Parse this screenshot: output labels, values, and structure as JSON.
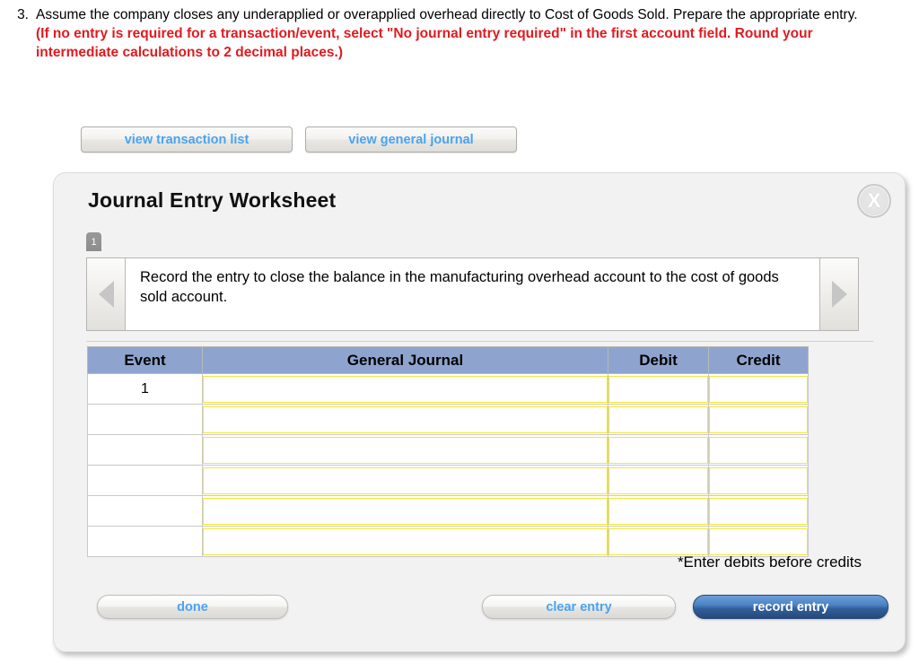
{
  "question": {
    "number": "3.",
    "text_plain": "Assume the company closes any underapplied or overapplied overhead directly to Cost of Goods Sold. Prepare the appropriate entry. ",
    "text_emphasis": "(If no entry is required for a transaction/event, select \"No journal entry required\" in the first account field. Round your intermediate calculations to 2 decimal places.)",
    "emphasis_color": "#e01b20"
  },
  "view_buttons": [
    {
      "label": "view transaction list",
      "name": "view-transaction-list-button"
    },
    {
      "label": "view general journal",
      "name": "view-general-journal-button"
    }
  ],
  "worksheet": {
    "title": "Journal Entry Worksheet",
    "close_icon": "close-icon",
    "close_glyph": "X",
    "tabs": [
      {
        "label": "1"
      }
    ],
    "nav": {
      "prev_icon": "chevron-left-icon",
      "next_icon": "chevron-right-icon",
      "prompt": "Record the entry to close the balance in the manufacturing overhead account to the cost of goods sold account."
    },
    "table": {
      "headers": [
        "Event",
        "General Journal",
        "Debit",
        "Credit"
      ],
      "header_color": "#8ea4ce",
      "input_border_color": "#f2e72f",
      "rows": [
        {
          "event": "1",
          "journal": "",
          "debit": "",
          "credit": ""
        },
        {
          "event": "",
          "journal": "",
          "debit": "",
          "credit": ""
        },
        {
          "event": "",
          "journal": "",
          "debit": "",
          "credit": ""
        },
        {
          "event": "",
          "journal": "",
          "debit": "",
          "credit": ""
        },
        {
          "event": "",
          "journal": "",
          "debit": "",
          "credit": ""
        },
        {
          "event": "",
          "journal": "",
          "debit": "",
          "credit": ""
        }
      ]
    },
    "note": "*Enter debits before credits",
    "footer_buttons": {
      "done": "done",
      "clear_entry": "clear entry",
      "record_entry": "record entry"
    }
  }
}
